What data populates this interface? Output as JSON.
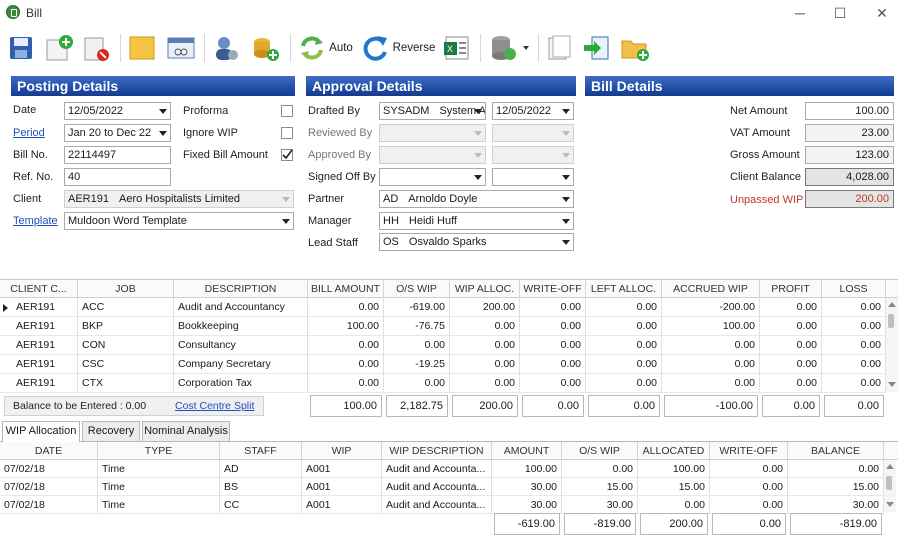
{
  "window": {
    "title": "Bill",
    "minimize": "─",
    "maximize": "☐",
    "close": "✕"
  },
  "toolbar": {
    "auto_label": "Auto",
    "reverse_label": "Reverse"
  },
  "posting": {
    "header": "Posting Details",
    "date_label": "Date",
    "date_value": "12/05/2022",
    "period_label": "Period",
    "period_value": "Jan 20 to Dec 22",
    "billno_label": "Bill No.",
    "billno_value": "22114497",
    "refno_label": "Ref. No.",
    "refno_value": "40",
    "client_label": "Client",
    "client_code": "AER191",
    "client_name": "Aero Hospitalists Limited",
    "template_label": "Template",
    "template_value": "Muldoon Word Template",
    "proforma_label": "Proforma",
    "ignorewip_label": "Ignore WIP",
    "fixed_label": "Fixed Bill Amount"
  },
  "approval": {
    "header": "Approval Details",
    "drafted_label": "Drafted By",
    "drafted_code": "SYSADM",
    "drafted_name": "System A",
    "drafted_date": "12/05/2022",
    "reviewed_label": "Reviewed By",
    "approved_label": "Approved By",
    "signed_label": "Signed Off By",
    "partner_label": "Partner",
    "partner_code": "AD",
    "partner_name": "Arnoldo Doyle",
    "manager_label": "Manager",
    "manager_code": "HH",
    "manager_name": "Heidi Huff",
    "lead_label": "Lead Staff",
    "lead_code": "OS",
    "lead_name": "Osvaldo Sparks"
  },
  "bill": {
    "header": "Bill Details",
    "net_label": "Net Amount",
    "net_value": "100.00",
    "vat_label": "VAT Amount",
    "vat_value": "23.00",
    "gross_label": "Gross Amount",
    "gross_value": "123.00",
    "balance_label": "Client Balance",
    "balance_value": "4,028.00",
    "unpassed_label": "Unpassed WIP",
    "unpassed_value": "200.00",
    "colors": {
      "unpassed": "#c0392b"
    }
  },
  "jobs": {
    "headers": [
      "CLIENT C...",
      "JOB",
      "DESCRIPTION",
      "BILL AMOUNT",
      "O/S WIP",
      "WIP ALLOC.",
      "WRITE-OFF",
      "LEFT ALLOC.",
      "ACCRUED WIP",
      "PROFIT",
      "LOSS"
    ],
    "rows": [
      [
        "AER191",
        "ACC",
        "Audit and Accountancy",
        "0.00",
        "-619.00",
        "200.00",
        "0.00",
        "0.00",
        "-200.00",
        "0.00",
        "0.00"
      ],
      [
        "AER191",
        "BKP",
        "Bookkeeping",
        "100.00",
        "-76.75",
        "0.00",
        "0.00",
        "0.00",
        "100.00",
        "0.00",
        "0.00"
      ],
      [
        "AER191",
        "CON",
        "Consultancy",
        "0.00",
        "0.00",
        "0.00",
        "0.00",
        "0.00",
        "0.00",
        "0.00",
        "0.00"
      ],
      [
        "AER191",
        "CSC",
        "Company Secretary",
        "0.00",
        "-19.25",
        "0.00",
        "0.00",
        "0.00",
        "0.00",
        "0.00",
        "0.00"
      ],
      [
        "AER191",
        "CTX",
        "Corporation Tax",
        "0.00",
        "0.00",
        "0.00",
        "0.00",
        "0.00",
        "0.00",
        "0.00",
        "0.00"
      ]
    ],
    "balance_text": "Balance to be Entered :  0.00",
    "cost_centre_link": "Cost Centre Split",
    "totals": [
      "100.00",
      "2,182.75",
      "200.00",
      "0.00",
      "0.00",
      "-100.00",
      "0.00",
      "0.00"
    ]
  },
  "tabs": [
    "WIP Allocation",
    "Recovery",
    "Nominal Analysis"
  ],
  "wip": {
    "headers": [
      "DATE",
      "TYPE",
      "STAFF",
      "WIP",
      "WIP DESCRIPTION",
      "AMOUNT",
      "O/S WIP",
      "ALLOCATED",
      "WRITE-OFF",
      "BALANCE"
    ],
    "rows": [
      [
        "07/02/18",
        "Time",
        "AD",
        "A001",
        "Audit and Accounta...",
        "100.00",
        "0.00",
        "100.00",
        "0.00",
        "0.00"
      ],
      [
        "07/02/18",
        "Time",
        "BS",
        "A001",
        "Audit and Accounta...",
        "30.00",
        "15.00",
        "15.00",
        "0.00",
        "15.00"
      ],
      [
        "07/02/18",
        "Time",
        "CC",
        "A001",
        "Audit and Accounta...",
        "30.00",
        "30.00",
        "0.00",
        "0.00",
        "30.00"
      ]
    ],
    "totals": [
      "-619.00",
      "-819.00",
      "200.00",
      "0.00",
      "-819.00"
    ]
  }
}
